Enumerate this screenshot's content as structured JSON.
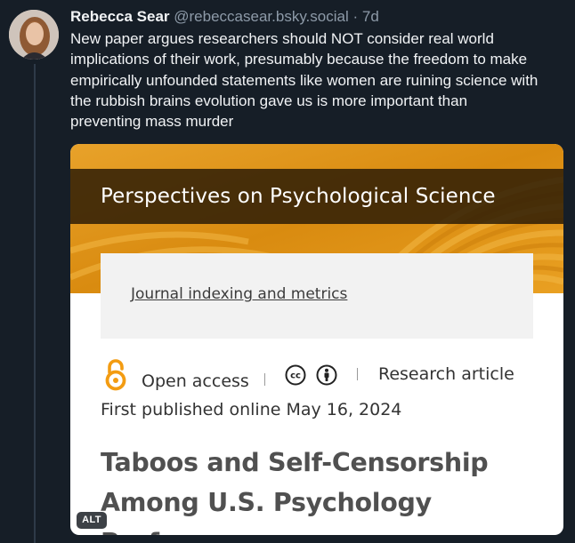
{
  "post": {
    "author": "Rebecca Sear",
    "handle": "@rebeccasear.bsky.social",
    "time_sep": " · ",
    "time": "7d",
    "text": "New paper argues researchers should NOT consider real world implications of their work, presumably because the freedom to make empirically unfounded statements like women are ruining science with the rubbish brains evolution gave us is more important than preventing mass murder"
  },
  "card": {
    "journal": "Perspectives on Psychological Science",
    "metrics_link": "Journal indexing and metrics",
    "open_access_label": "Open access",
    "article_type": "Research article",
    "published": "First published online May 16, 2024",
    "title": "Taboos and Self-Censorship Among U.S. Psychology Professors",
    "alt_badge": "ALT"
  },
  "icons": {
    "open_access": "open-access-lock-icon",
    "cc": "creative-commons-icon",
    "by": "attribution-icon"
  },
  "colors": {
    "background": "#161e27",
    "banner": "#e39a18",
    "open_access_orange": "#f39c12"
  }
}
